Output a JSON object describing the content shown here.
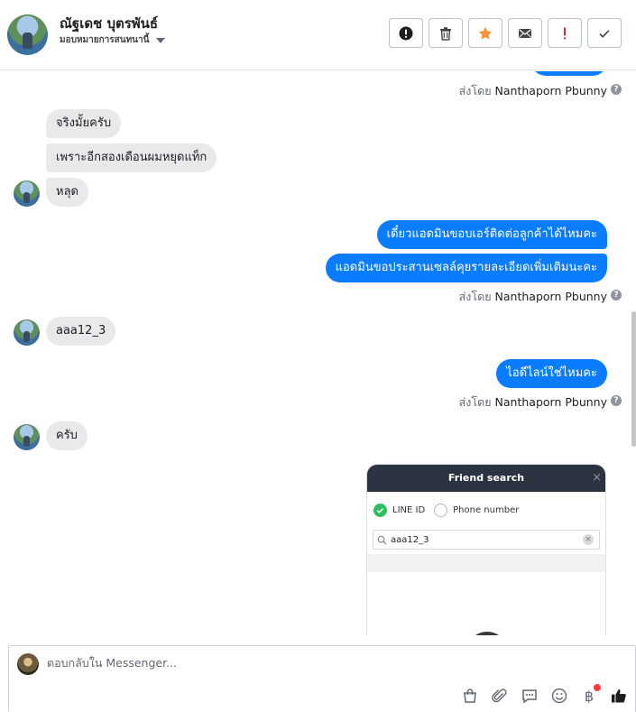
{
  "header": {
    "contact_name": "ณัฐเดช บุตรพันธ์",
    "assign_label": "มอบหมายการสนทนานี้",
    "actions": [
      {
        "name": "spam-button",
        "icon": "exclamation-circle-icon"
      },
      {
        "name": "delete-button",
        "icon": "trash-icon"
      },
      {
        "name": "star-button",
        "icon": "star-icon"
      },
      {
        "name": "mark-unread-button",
        "icon": "envelope-icon"
      },
      {
        "name": "follow-up-button",
        "icon": "exclamation-mark-icon"
      },
      {
        "name": "mark-done-button",
        "icon": "checkmark-icon"
      }
    ],
    "colors": {
      "star": "#f7923b",
      "followup": "#e41e3f"
    }
  },
  "conversation": {
    "sent_by_prefix": "ส่งโดย",
    "sender_name": "Nanthaporn Pbunny",
    "help_glyph": "?",
    "messages": {
      "in_1": "จริงมั้ยครับ",
      "in_2": "เพราะอีกสองเดือนผมหยุดแท็ก",
      "in_3": "หลุด",
      "out_1": "เดี๋ยวแอดมินขอบเอร์ติดต่อลูกค้าได้ไหมคะ",
      "out_2": "แอดมินขอประสานเซลล์คุยรายละเอียดเพิ่มเติมนะคะ",
      "in_4": "aaa12_3",
      "out_3": "ไอดีไลน์ใช่ไหมคะ",
      "in_5": "ครับ"
    },
    "colors": {
      "outgoing": "#0a7cff",
      "incoming": "#e9e9eb"
    },
    "shared_image": {
      "title": "Friend search",
      "close": "×",
      "option_line_id": "LINE ID",
      "option_phone": "Phone number",
      "search_value": "aaa12_3",
      "clear": "×"
    }
  },
  "composer": {
    "placeholder": "ตอบกลับใน Messenger...",
    "tools": [
      "shopping-bag-icon",
      "paperclip-icon",
      "saved-reply-icon",
      "emoji-icon",
      "baht-icon",
      "like-icon"
    ],
    "baht_glyph": "฿"
  }
}
